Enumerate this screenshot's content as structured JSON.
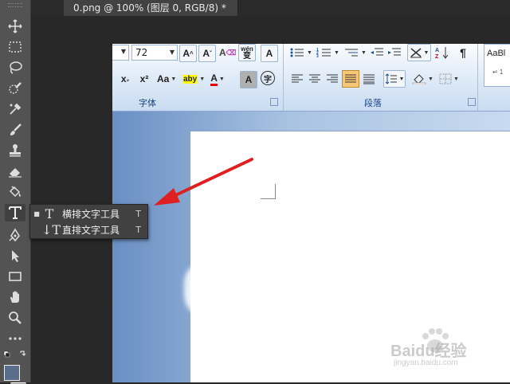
{
  "document_tab": {
    "title": "0.png @ 100% (图层 0, RGB/8) *"
  },
  "ribbon": {
    "font_size_value": "72",
    "group_font_label": "字体",
    "group_paragraph_label": "段落",
    "styles_preview": "AaBl",
    "styles_return": "↵ 1",
    "buttons": {
      "grow_font": "A",
      "shrink_font": "A",
      "clear_format": "A",
      "phonetic": "wén",
      "char_border": "A",
      "subscript": "x",
      "superscript": "x²",
      "change_case": "Aa",
      "highlight": "aby",
      "font_color": "A",
      "char_shading": "A",
      "enclose_char": "字"
    }
  },
  "tool_flyout": {
    "items": [
      {
        "label": "横排文字工具",
        "shortcut": "T",
        "selected": true
      },
      {
        "label": "直排文字工具",
        "shortcut": "T",
        "selected": false
      }
    ]
  },
  "colors": {
    "foreground": "#5a6e8c",
    "background": "#ffffff",
    "arrow": "#e02020",
    "toolbar": "#535353"
  },
  "watermark": {
    "brand": "Baidu经验",
    "url": "jingyan.baidu.com"
  }
}
